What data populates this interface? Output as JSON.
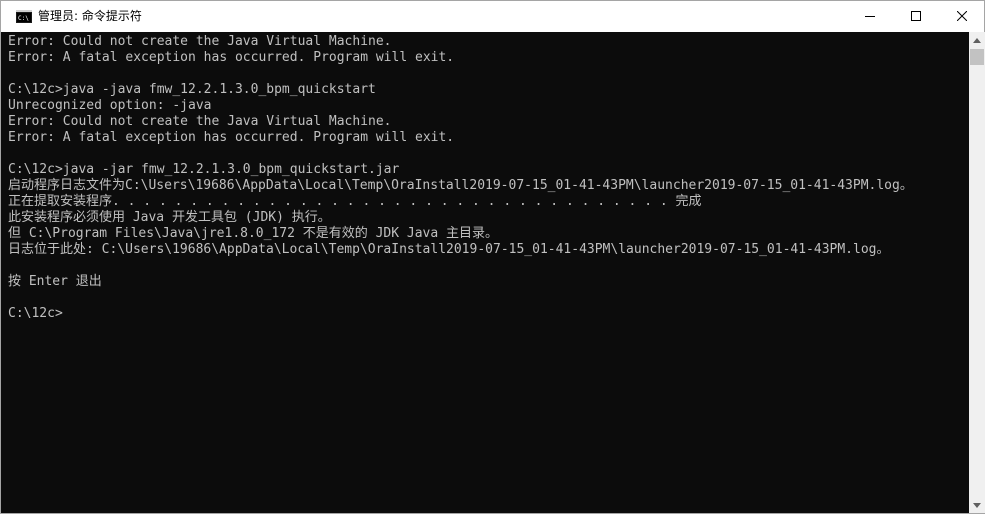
{
  "window": {
    "title": "管理员: 命令提示符",
    "icon": "cmd-icon"
  },
  "caption_buttons": {
    "minimize_icon": "minimize-icon",
    "maximize_icon": "maximize-icon",
    "close_icon": "close-icon"
  },
  "console": {
    "lines": [
      "Error: Could not create the Java Virtual Machine.",
      "Error: A fatal exception has occurred. Program will exit.",
      "",
      "C:\\12c>java -java fmw_12.2.1.3.0_bpm_quickstart",
      "Unrecognized option: -java",
      "Error: Could not create the Java Virtual Machine.",
      "Error: A fatal exception has occurred. Program will exit.",
      "",
      "C:\\12c>java -jar fmw_12.2.1.3.0_bpm_quickstart.jar",
      "启动程序日志文件为C:\\Users\\19686\\AppData\\Local\\Temp\\OraInstall2019-07-15_01-41-43PM\\launcher2019-07-15_01-41-43PM.log。",
      "正在提取安装程序. . . . . . . . . . . . . . . . . . . . . . . . . . . . . . . . . . . . 完成",
      "此安装程序必须使用 Java 开发工具包 (JDK) 执行。",
      "但 C:\\Program Files\\Java\\jre1.8.0_172 不是有效的 JDK Java 主目录。",
      "日志位于此处: C:\\Users\\19686\\AppData\\Local\\Temp\\OraInstall2019-07-15_01-41-43PM\\launcher2019-07-15_01-41-43PM.log。",
      "",
      "按 Enter 退出",
      "",
      "C:\\12c>"
    ]
  },
  "scrollbar": {
    "up_icon": "scroll-up-arrow-icon",
    "down_icon": "scroll-down-arrow-icon"
  },
  "colors": {
    "console_bg": "#0c0c0c",
    "console_fg": "#c0c0c0",
    "scrollbar_track": "#f0f0f0",
    "scrollbar_thumb": "#c2c2c2"
  }
}
